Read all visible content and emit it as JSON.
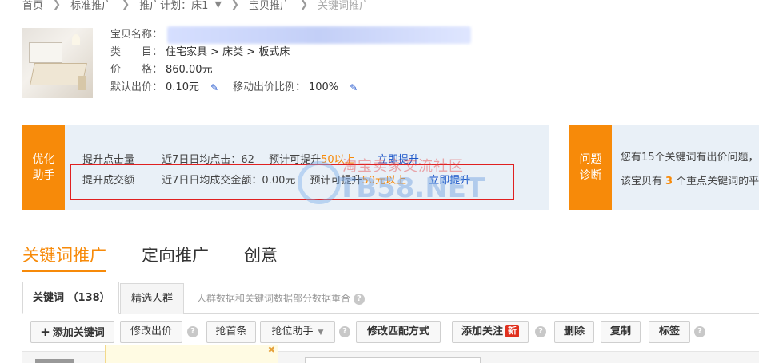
{
  "breadcrumb": {
    "items": [
      "首页",
      "标准推广",
      "推广计划：床1",
      "宝贝推广",
      "关键词推广"
    ]
  },
  "product": {
    "name_label": "宝贝名称：",
    "category_label": "类　　目：",
    "category_value": "住宅家具 > 床类 > 板式床",
    "price_label": "价　　格：",
    "price_value": "860.00元",
    "default_bid_label": "默认出价：",
    "default_bid_value": "0.10元",
    "mobile_ratio_label": "移动出价比例：",
    "mobile_ratio_value": "100%"
  },
  "optimization": {
    "tag": "优化助手",
    "rows": [
      {
        "name": "提升点击量",
        "stat": "近7日日均点击：62",
        "predict_prefix": "预计可提升",
        "predict_value": "50以上",
        "link": "立即提升"
      },
      {
        "name": "提升成交额",
        "stat": "近7日日均成交金额：0.00元",
        "predict_prefix": "预计可提升",
        "predict_value": "50元以上",
        "link": "立即提升"
      }
    ]
  },
  "diagnosis": {
    "tag": "问题诊断",
    "line1": "您有15个关键词有出价问题，",
    "line2_prefix": "该宝贝有",
    "line2_count": "3",
    "line2_suffix": "个重点关键词的平"
  },
  "watermark": {
    "text_cn": "淘宝卖家交流社区",
    "text_en": "TB58.NET"
  },
  "main_tabs": [
    "关键词推广",
    "定向推广",
    "创意"
  ],
  "sub_tabs": {
    "keywords": "关键词 （138）",
    "crowd": "精选人群",
    "note": "人群数据和关键词数据部分数据重合"
  },
  "toolbar": {
    "add_keyword": "添加关键词",
    "modify_bid": "修改出价",
    "grab_first": "抢首条",
    "rank_helper": "抢位助手",
    "modify_match": "修改匹配方式",
    "add_follow": "添加关注",
    "new_badge": "新",
    "delete": "删除",
    "copy": "复制",
    "tag": "标签"
  },
  "colors": {
    "accent": "#f78a09",
    "link": "#1a55c8",
    "highlight_box": "#e02020",
    "panel_bg": "#e9f0f7"
  }
}
